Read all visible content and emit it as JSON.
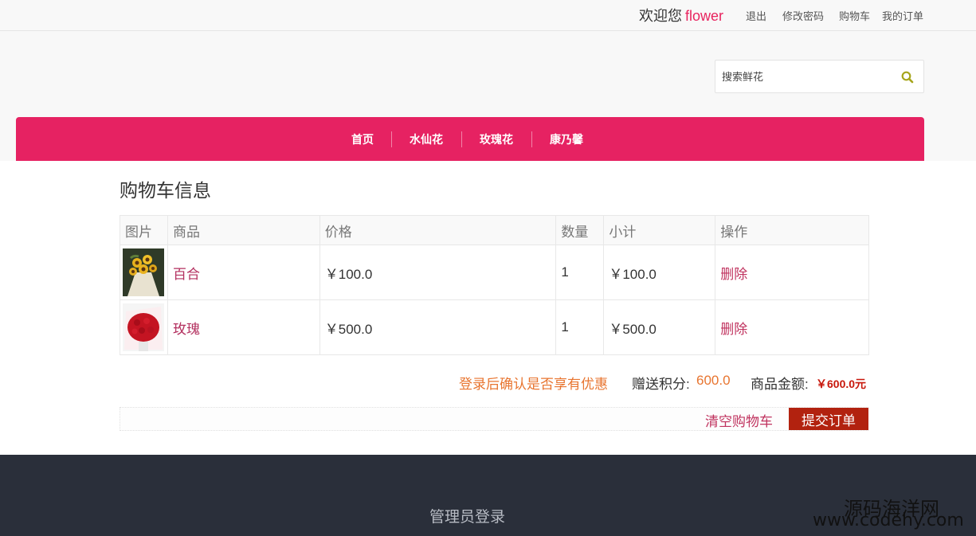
{
  "topbar": {
    "welcome_text": "欢迎您",
    "username": "flower",
    "links": {
      "logout": "退出",
      "change_password": "修改密码",
      "cart": "购物车",
      "my_orders": "我的订单"
    }
  },
  "search": {
    "placeholder": "搜索鲜花",
    "icon": "search-icon"
  },
  "nav": {
    "items": [
      "首页",
      "水仙花",
      "玫瑰花",
      "康乃馨"
    ]
  },
  "cart": {
    "title": "购物车信息",
    "headers": [
      "图片",
      "商品",
      "价格",
      "数量",
      "小计",
      "操作"
    ],
    "rows": [
      {
        "image": "sunflower-bouquet",
        "name": "百合",
        "price": "￥100.0",
        "quantity": "1",
        "subtotal": "￥100.0",
        "action": "删除"
      },
      {
        "image": "red-rose-bouquet",
        "name": "玫瑰",
        "price": "￥500.0",
        "quantity": "1",
        "subtotal": "￥500.0",
        "action": "删除"
      }
    ],
    "promo_text": "登录后确认是否享有优惠",
    "points_label": "赠送积分:",
    "points_value": "600.0",
    "amount_label": "商品金额:",
    "amount_value": "￥600.0元",
    "clear_label": "清空购物车",
    "submit_label": "提交订单"
  },
  "footer": {
    "admin_login": "管理员登录"
  },
  "watermark": {
    "line1": "源码海洋网",
    "line2": "www.codehy.com"
  },
  "colors": {
    "accent": "#e62262",
    "submit": "#b2220f",
    "footer_bg": "#2a2f3a",
    "orange": "#e87530"
  }
}
